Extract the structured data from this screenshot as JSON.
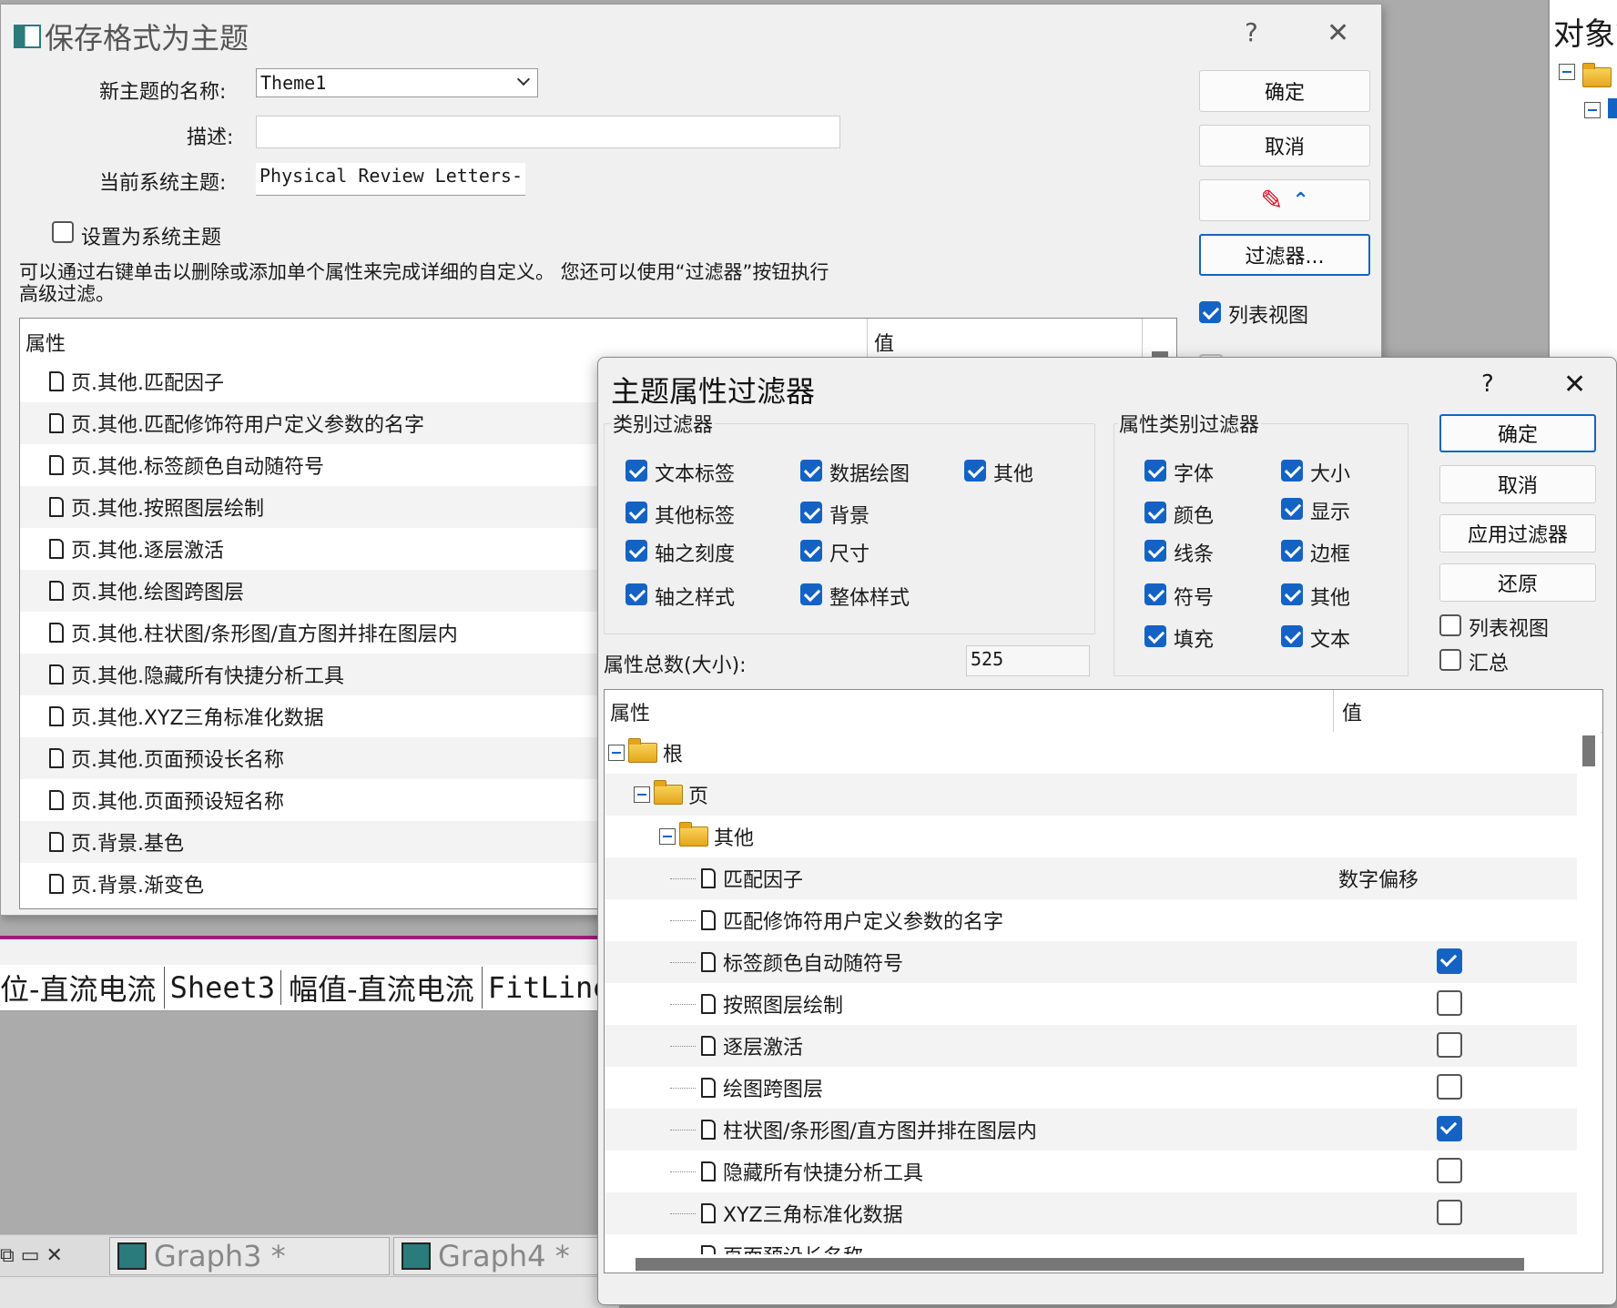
{
  "bg_window": {
    "right_panel_title": "对象管",
    "sheet_tabs": [
      "位-直流电流",
      "Sheet3",
      "幅值-直流电流",
      "FitLine"
    ],
    "graph_tabs": [
      "Graph3 *",
      "Graph4 *"
    ]
  },
  "save_dialog": {
    "title": "保存格式为主题",
    "help": "?",
    "close": "✕",
    "name_label": "新主题的名称:",
    "name_value": "Theme1",
    "desc_label": "描述:",
    "desc_value": "",
    "system_theme_label": "当前系统主题:",
    "system_theme_value": "Physical Review Letters-(",
    "set_system_label": "设置为系统主题",
    "set_system_checked": false,
    "hint": "可以通过右键单击以删除或添加单个属性来完成详细的自定义。 您还可以使用“过滤器”按钮执行高级过滤。",
    "ok": "确定",
    "cancel": "取消",
    "filter": "过滤器...",
    "list_view_label": "列表视图",
    "list_view_checked": true,
    "summary_label": "汇总",
    "col_property": "属性",
    "col_value": "值",
    "rows": [
      "页.其他.匹配因子",
      "页.其他.匹配修饰符用户定义参数的名字",
      "页.其他.标签颜色自动随符号",
      "页.其他.按照图层绘制",
      "页.其他.逐层激活",
      "页.其他.绘图跨图层",
      "页.其他.柱状图/条形图/直方图并排在图层内",
      "页.其他.隐藏所有快捷分析工具",
      "页.其他.XYZ三角标准化数据",
      "页.其他.页面预设长名称",
      "页.其他.页面预设短名称",
      "页.背景.基色",
      "页.背景.渐变色"
    ]
  },
  "filter_dialog": {
    "title": "主题属性过滤器",
    "help": "?",
    "close": "✕",
    "category_group": "类别过滤器",
    "categories": [
      {
        "label": "文本标签",
        "checked": true
      },
      {
        "label": "数据绘图",
        "checked": true
      },
      {
        "label": "其他",
        "checked": true
      },
      {
        "label": "其他标签",
        "checked": true
      },
      {
        "label": "背景",
        "checked": true
      },
      {
        "label": "轴之刻度",
        "checked": true
      },
      {
        "label": "尺寸",
        "checked": true
      },
      {
        "label": "轴之样式",
        "checked": true
      },
      {
        "label": "整体样式",
        "checked": true
      }
    ],
    "attr_group": "属性类别过滤器",
    "attrs": [
      {
        "label": "字体",
        "checked": true
      },
      {
        "label": "大小",
        "checked": true
      },
      {
        "label": "颜色",
        "checked": true
      },
      {
        "label": "显示",
        "checked": true
      },
      {
        "label": "线条",
        "checked": true
      },
      {
        "label": "边框",
        "checked": true
      },
      {
        "label": "符号",
        "checked": true
      },
      {
        "label": "其他",
        "checked": true
      },
      {
        "label": "填充",
        "checked": true
      },
      {
        "label": "文本",
        "checked": true
      }
    ],
    "count_label": "属性总数(大小):",
    "count_value": "525",
    "ok": "确定",
    "cancel": "取消",
    "apply": "应用过滤器",
    "restore": "还原",
    "list_view_label": "列表视图",
    "list_view_checked": false,
    "summary_label": "汇总",
    "summary_checked": false,
    "col_property": "属性",
    "col_value": "值",
    "tree_root": "根",
    "tree_page": "页",
    "tree_other": "其他",
    "tree_items": [
      {
        "label": "匹配因子",
        "value": "数字偏移",
        "check": null
      },
      {
        "label": "匹配修饰符用户定义参数的名字",
        "value": "",
        "check": null
      },
      {
        "label": "标签颜色自动随符号",
        "value": "",
        "check": true
      },
      {
        "label": "按照图层绘制",
        "value": "",
        "check": false
      },
      {
        "label": "逐层激活",
        "value": "",
        "check": false
      },
      {
        "label": "绘图跨图层",
        "value": "",
        "check": false
      },
      {
        "label": "柱状图/条形图/直方图并排在图层内",
        "value": "",
        "check": true
      },
      {
        "label": "隐藏所有快捷分析工具",
        "value": "",
        "check": false
      },
      {
        "label": "XYZ三角标准化数据",
        "value": "",
        "check": false
      },
      {
        "label": "页面预设长名称",
        "value": "",
        "check": null
      }
    ]
  },
  "colors": {
    "accent": "#1463c4",
    "dialog_bg": "#f0f0f0",
    "backdrop": "#ababab"
  }
}
